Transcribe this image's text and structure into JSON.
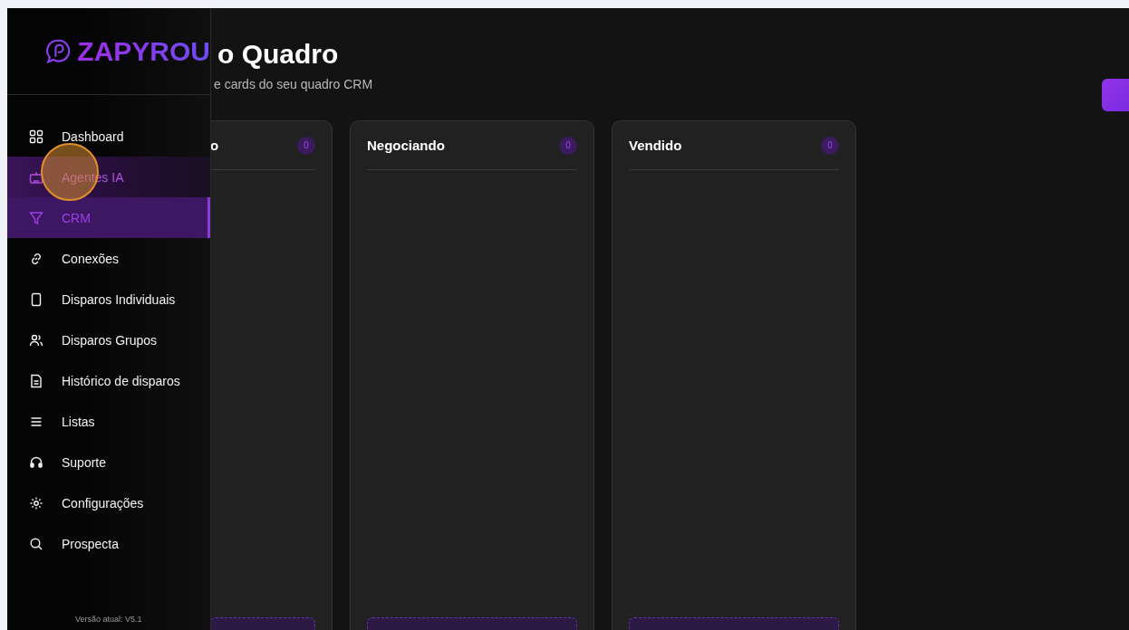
{
  "brand": {
    "name": "ZAPYROU"
  },
  "header": {
    "title": "o Quadro",
    "subtitle": "e cards do seu quadro CRM"
  },
  "columns": [
    {
      "title": "o",
      "count": "0"
    },
    {
      "title": "Negociando",
      "count": "0"
    },
    {
      "title": "Vendido",
      "count": "0"
    }
  ],
  "sidebar": {
    "items": [
      {
        "label": "Dashboard",
        "selected": false,
        "hovered": false
      },
      {
        "label": "Agentes IA",
        "selected": false,
        "hovered": true
      },
      {
        "label": "CRM",
        "selected": true,
        "hovered": false
      },
      {
        "label": "Conexões",
        "selected": false,
        "hovered": false
      },
      {
        "label": "Disparos Individuais",
        "selected": false,
        "hovered": false
      },
      {
        "label": "Disparos Grupos",
        "selected": false,
        "hovered": false
      },
      {
        "label": "Histórico de disparos",
        "selected": false,
        "hovered": false
      },
      {
        "label": "Listas",
        "selected": false,
        "hovered": false
      },
      {
        "label": "Suporte",
        "selected": false,
        "hovered": false
      },
      {
        "label": "Configurações",
        "selected": false,
        "hovered": false
      },
      {
        "label": "Prospecta",
        "selected": false,
        "hovered": false
      }
    ],
    "version": "Versão atual: V5.1"
  }
}
